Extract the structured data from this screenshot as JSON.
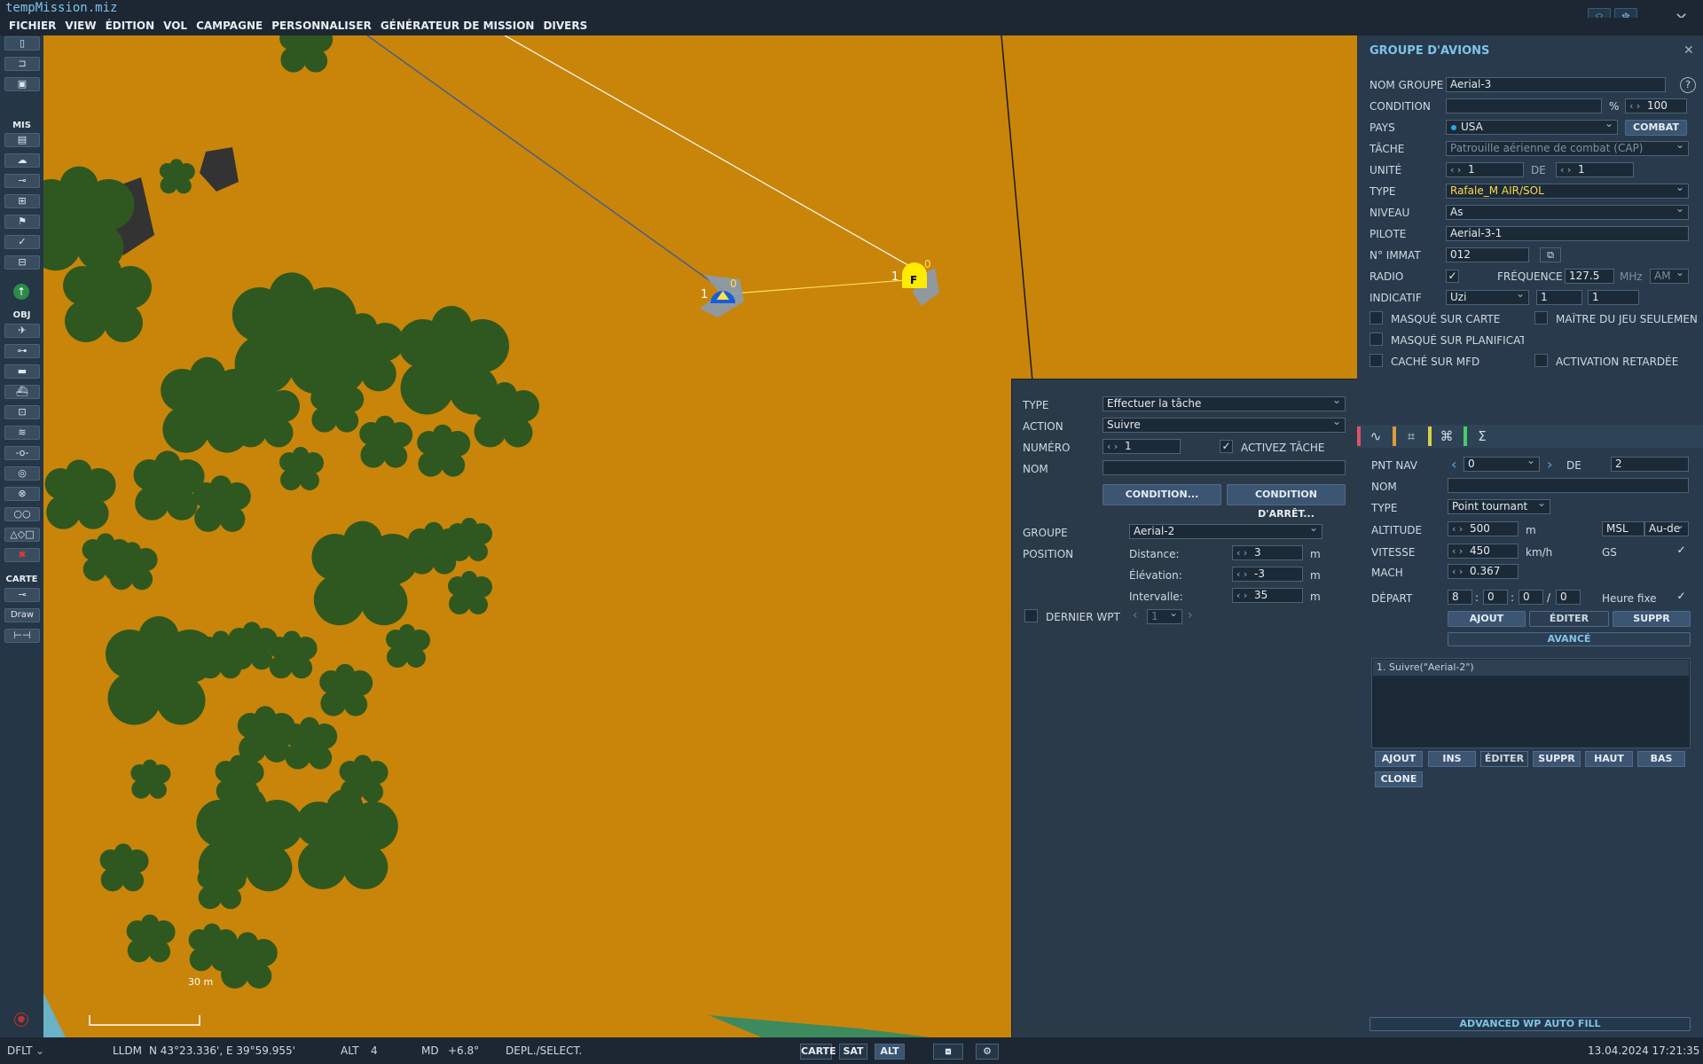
{
  "window": {
    "title": "tempMission.miz"
  },
  "menu": [
    "FICHIER",
    "VIEW",
    "ÉDITION",
    "VOL",
    "CAMPAGNE",
    "PERSONNALISER",
    "GÉNÉRATEUR DE MISSION",
    "DIVERS"
  ],
  "toolbar": {
    "sections": [
      "MIS",
      "OBJ",
      "CARTE"
    ],
    "draw_label": "Draw"
  },
  "map": {
    "scale_label": "30 m",
    "unit_blue": {
      "number": "1",
      "count": "0"
    },
    "unit_yellow": {
      "number": "1",
      "count": "0",
      "letter": "F"
    }
  },
  "group_panel": {
    "title": "GROUPE D'AVIONS",
    "labels": {
      "nom_groupe": "NOM GROUPE",
      "condition": "CONDITION",
      "pays": "PAYS",
      "tache": "TÂCHE",
      "unite": "UNITÉ",
      "type": "TYPE",
      "niveau": "NIVEAU",
      "pilote": "PILOTE",
      "immat": "N° IMMAT",
      "radio": "RADIO",
      "frequence": "FRÉQUENCE",
      "indicatif": "INDICATIF",
      "de": "DE",
      "pct": "%",
      "mhz": "MHz"
    },
    "values": {
      "nom_groupe": "Aerial-3",
      "condition": "",
      "condition_pct": "100",
      "pays": "USA",
      "tache": "Patrouille aérienne de combat (CAP)",
      "unite": "1",
      "unite_de": "1",
      "type": "Rafale_M AIR/SOL",
      "niveau": "As",
      "pilote": "Aerial-3-1",
      "immat": "012",
      "frequence": "127.5",
      "modulation": "AM",
      "indicatif": "Uzi",
      "indicatif_1": "1",
      "indicatif_2": "1"
    },
    "buttons": {
      "combat": "COMBAT",
      "help": "?"
    },
    "checkboxes": {
      "masque_carte": "MASQUÉ SUR CARTE",
      "maitre_jeu": "MAÎTRE DU JEU SEULEMEN",
      "masque_planif": "MASQUÉ SUR PLANIFICATI",
      "cache_mfd": "CACHÉ SUR MFD",
      "activation": "ACTIVATION RETARDÉE"
    }
  },
  "task_panel": {
    "labels": {
      "type": "TYPE",
      "action": "ACTION",
      "numero": "NUMÉRO",
      "nom": "NOM",
      "groupe": "GROUPE",
      "position": "POSITION",
      "distance": "Distance:",
      "elevation": "Élévation:",
      "intervalle": "Intervalle:",
      "dernier_wpt": "DERNIER WPT",
      "activez": "ACTIVEZ TÂCHE",
      "m": "m"
    },
    "values": {
      "type": "Effectuer la tâche",
      "action": "Suivre",
      "numero": "1",
      "nom": "",
      "groupe": "Aerial-2",
      "distance": "3",
      "elevation": "-3",
      "intervalle": "35",
      "dernier_wpt": "1"
    },
    "buttons": {
      "condition": "CONDITION...",
      "condition_arret": "CONDITION D'ARRÊT..."
    }
  },
  "wp_panel": {
    "labels": {
      "pnt_nav": "PNT NAV",
      "de": "DE",
      "nom": "NOM",
      "type": "TYPE",
      "altitude": "ALTITUDE",
      "vitesse": "VITESSE",
      "mach": "MACH",
      "depart": "DÉPART",
      "m": "m",
      "kmh": "km/h",
      "gs": "GS",
      "heure_fixe": "Heure fixe"
    },
    "values": {
      "pnt_nav": "0",
      "de": "2",
      "nom": "",
      "type": "Point tournant",
      "altitude": "500",
      "alt_ref": "MSL",
      "alt_mode": "Au-de",
      "vitesse": "450",
      "mach": "0.367",
      "dep_h": "8",
      "dep_m": "0",
      "dep_s": "0",
      "dep_d": "0"
    },
    "buttons": {
      "ajout": "AJOUT",
      "editer": "ÉDITER",
      "suppr": "SUPPR",
      "avance": "AVANCÉ",
      "ins": "INS",
      "haut": "HAUT",
      "bas": "BAS",
      "clone": "CLONE",
      "advanced_fill": "ADVANCED WP AUTO FILL"
    },
    "actions": [
      "1. Suivre(\"Aerial-2\")"
    ]
  },
  "status": {
    "dflt": "DFLT",
    "lldm": "LLDM",
    "coords": "N 43°23.336', E 39°59.955'",
    "alt_label": "ALT",
    "alt_value": "4",
    "md_label": "MD",
    "md_value": "+6.8°",
    "mode": "DEPL./SELECT.",
    "carte": "CARTE",
    "sat": "SAT",
    "alt_btn": "ALT",
    "datetime": "13.04.2024 17:21:35"
  }
}
